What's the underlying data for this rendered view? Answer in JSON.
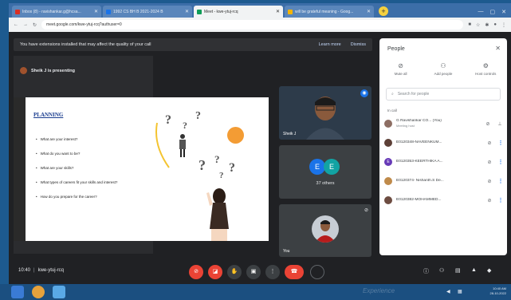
{
  "browser": {
    "tabs": [
      {
        "label": "Inbox (8) - ravishankar.g@hcsa...",
        "fav_color": "#d93025",
        "active": false
      },
      {
        "label": "1992 CS BH B 2021-2024 B",
        "fav_color": "#1a73e8",
        "active": false
      },
      {
        "label": "Meet - kwe-ytuj-rcq",
        "fav_color": "#0f9d58",
        "active": true
      },
      {
        "label": "will be grateful meaning - Goog...",
        "fav_color": "#f4b400",
        "active": false
      }
    ],
    "new_tab": "+",
    "url": "meet.google.com/kwe-ytuj-rcq?authuser=0"
  },
  "banner": {
    "text": "You have extensions installed that may affect the quality of your call",
    "learn_more": "Learn more",
    "dismiss": "Dismiss"
  },
  "presenting": {
    "label": "Sheik J is presenting"
  },
  "slide": {
    "title": "PLANNING",
    "bullets": [
      "What are your interest?",
      "What do you want to be?",
      "What are your skills?",
      "What types of careers fit your skills and interest?",
      "How do you prepare for the career?"
    ],
    "orange": "#f39c34"
  },
  "tiles": {
    "speaker_name": "Sheik J",
    "others_initials": [
      "E",
      "E"
    ],
    "others_colors": [
      "#1a73e8",
      "#12a3a3"
    ],
    "others_count": "37 others",
    "you_label": "You"
  },
  "people": {
    "title": "People",
    "actions": [
      {
        "label": "Mute all",
        "icon": "mic-off-icon"
      },
      {
        "label": "Add people",
        "icon": "add-person-icon"
      },
      {
        "label": "Host controls",
        "icon": "host-controls-icon"
      }
    ],
    "search_placeholder": "Search for people",
    "in_call": "In call",
    "participants": [
      {
        "name": "G Ravishankar CO...",
        "tag": "(You)",
        "sub": "Meeting host",
        "color": "#8d6e63",
        "initial": ""
      },
      {
        "name": "E0120348-NAVEENKUM...",
        "sub": "",
        "color": "#5d4037",
        "initial": ""
      },
      {
        "name": "E0120353-KEERTHIKA A...",
        "sub": "",
        "color": "#673ab7",
        "initial": "E"
      },
      {
        "name": "E0120374- Nishanth.S De...",
        "sub": "",
        "color": "#bf8a4a",
        "initial": ""
      },
      {
        "name": "E0120382-MOHAMMED...",
        "sub": "",
        "color": "#6d4c41",
        "initial": ""
      }
    ]
  },
  "meeting": {
    "time": "10:40",
    "code": "kwe-ytuj-rcq"
  },
  "taskbar": {
    "watermark": "Experience",
    "clock_time": "10:40 AM",
    "clock_date": "28-10-2022"
  }
}
